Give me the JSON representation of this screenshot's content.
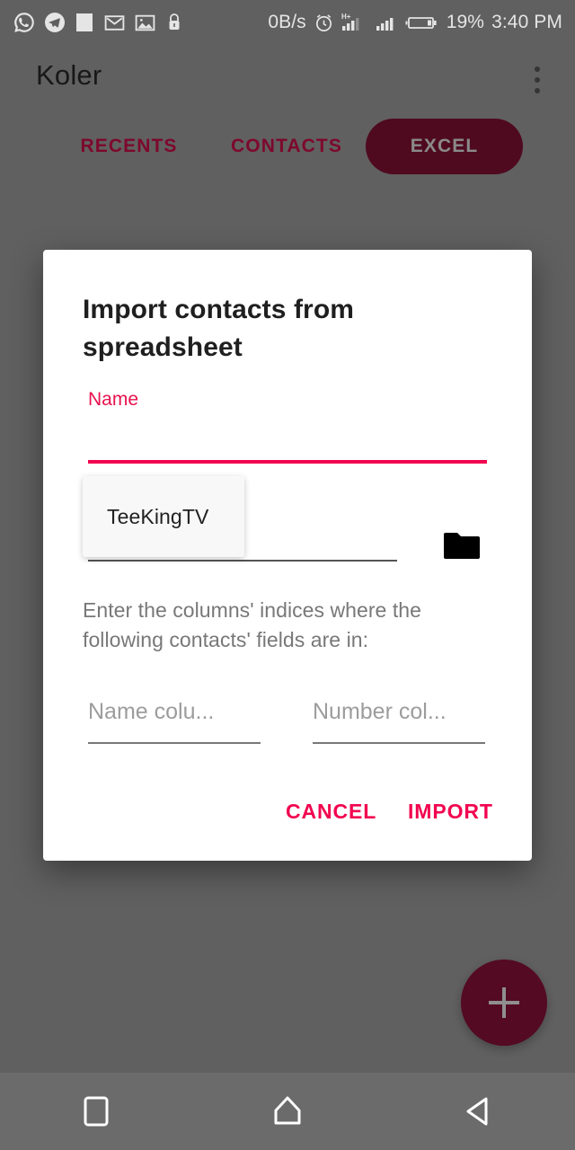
{
  "status_bar": {
    "left_icons": [
      {
        "name": "whatsapp-icon",
        "label": "WhatsApp"
      },
      {
        "name": "telegram-icon",
        "label": "Telegram"
      },
      {
        "name": "white-square-icon",
        "label": "App notification"
      },
      {
        "name": "gmail-icon",
        "label": "Gmail"
      },
      {
        "name": "gallery-image-icon",
        "label": "Screenshot"
      },
      {
        "name": "lock-icon",
        "label": "Secure"
      }
    ],
    "network_speed": "0B/s",
    "alarm_icon": "alarm-clock-icon",
    "signal_hplus_label": "H+",
    "battery_percent": "19%",
    "clock": "3:40 PM"
  },
  "toolbar": {
    "title": "Koler",
    "overflow_menu": "more-options"
  },
  "tabs": [
    {
      "label": "RECENTS",
      "selected": false
    },
    {
      "label": "CONTACTS",
      "selected": false
    },
    {
      "label": "EXCEL",
      "selected": true
    }
  ],
  "fab": {
    "icon": "plus-icon",
    "label": "+"
  },
  "dialog": {
    "title": "Import contacts from spreadsheet",
    "name_label": "Name",
    "name_value": "",
    "autocomplete_suggestion": "TeeKingTV",
    "file_picker_icon": "folder-icon",
    "instruction": "Enter the columns' indices where the following contacts' fields are in:",
    "name_column_placeholder": "Name colu...",
    "name_column_value": "",
    "number_column_placeholder": "Number col...",
    "number_column_value": "",
    "cancel_label": "CANCEL",
    "import_label": "IMPORT"
  },
  "navigation_bar": {
    "recents": "recents-square",
    "home": "home-pentagon",
    "back": "back-triangle"
  },
  "colors": {
    "accent_pink": "#f2044f",
    "tab_text": "#8c0a33",
    "tab_selected_bg": "#590c24",
    "fab_bg": "#5e0c26",
    "app_background": "#6b6b6b",
    "dialog_bg": "#ffffff",
    "muted_text": "#787878"
  }
}
